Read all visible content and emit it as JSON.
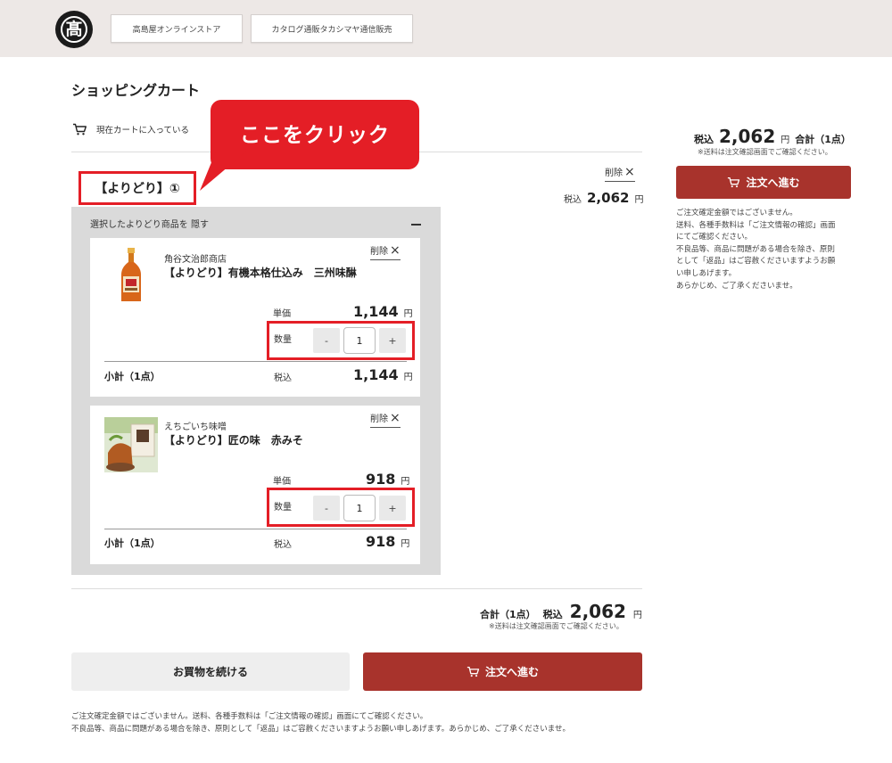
{
  "header": {
    "logo_text": "髙",
    "nav_buttons": [
      "高島屋オンラインストア",
      "カタログ通販タカシマヤ通信販売"
    ]
  },
  "page_title": "ショッピングカート",
  "cart_status": "現在カートに入っている",
  "callout": "ここをクリック",
  "group": {
    "title": "【よりどり】①",
    "delete_label": "削除",
    "tax_label": "税込",
    "total": "2,062",
    "yen": "円",
    "panel_label": "選択したよりどり商品を 隠す",
    "items": [
      {
        "shop": "角谷文治郎商店",
        "name": "【よりどり】有機本格仕込み　三州味醂",
        "delete_label": "削除",
        "unit_price_label": "単価",
        "unit_price": "1,144",
        "quantity_label": "数量",
        "minus": "-",
        "quantity": "1",
        "plus": "+",
        "subtotal_label": "小計（1点）",
        "subtotal_tax_label": "税込",
        "subtotal": "1,144",
        "yen": "円"
      },
      {
        "shop": "えちごいち味噌",
        "name": "【よりどり】匠の味　赤みそ",
        "delete_label": "削除",
        "unit_price_label": "単価",
        "unit_price": "918",
        "quantity_label": "数量",
        "minus": "-",
        "quantity": "1",
        "plus": "+",
        "subtotal_label": "小計（1点）",
        "subtotal_tax_label": "税込",
        "subtotal": "918",
        "yen": "円"
      }
    ]
  },
  "bottom_total": {
    "label": "合計（1点）",
    "tax_label": "税込",
    "amount": "2,062",
    "yen": "円",
    "shipping_note": "※送料は注文確認画面でご確認ください。"
  },
  "buttons": {
    "continue": "お買物を続ける",
    "checkout": "注文へ進む"
  },
  "footer_notes": [
    "ご注文確定金額ではございません。送料、各種手数料は「ご注文情報の確認」画面にてご確認ください。",
    "不良品等、商品に問題がある場合を除き、原則として「返品」はご容赦くださいますようお願い申しあげます。あらかじめ、ご了承くださいませ。"
  ],
  "sidebar": {
    "tax_label": "税込",
    "amount": "2,062",
    "yen": "円",
    "count_label": "合計（1点）",
    "shipping_note": "※送料は注文確認画面でご確認ください。",
    "checkout": "注文へ進む",
    "notes": [
      "ご注文確定金額ではございません。",
      "送料、各種手数料は「ご注文情報の確認」画面",
      "にてご確認ください。",
      "不良品等、商品に問題がある場合を除き、原則",
      "として「返品」はご容赦くださいますようお願",
      "い申しあげます。",
      "あらかじめ、ご了承くださいませ。"
    ]
  },
  "colors": {
    "accent": "#a8332c",
    "highlight": "#e41e26",
    "header_bg": "#ede8e6",
    "panel_bg": "#dadada"
  }
}
